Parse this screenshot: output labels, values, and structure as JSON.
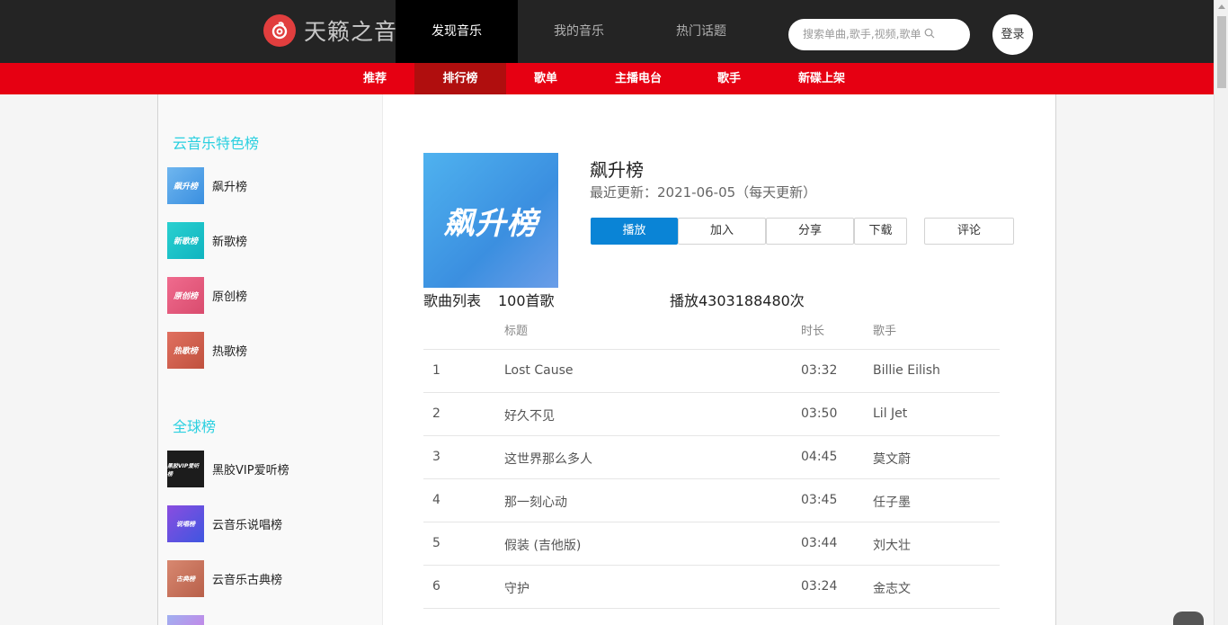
{
  "header": {
    "logo_text": "天籁之音",
    "nav": [
      "发现音乐",
      "我的音乐",
      "热门话题"
    ],
    "search_placeholder": "搜索单曲,歌手,视频,歌单",
    "login_label": "登录"
  },
  "subnav": [
    "推荐",
    "排行榜",
    "歌单",
    "主播电台",
    "歌手",
    "新碟上架"
  ],
  "sidebar": {
    "featured_title": "云音乐特色榜",
    "featured": [
      {
        "label": "飙升榜",
        "thumb": "飙升榜"
      },
      {
        "label": "新歌榜",
        "thumb": "新歌榜"
      },
      {
        "label": "原创榜",
        "thumb": "原创榜"
      },
      {
        "label": "热歌榜",
        "thumb": "热歌榜"
      }
    ],
    "global_title": "全球榜",
    "global": [
      {
        "label": "黑胶VIP爱听榜",
        "thumb": "黑胶VIP爱听榜"
      },
      {
        "label": "云音乐说唱榜",
        "thumb": "说唱榜"
      },
      {
        "label": "云音乐古典榜",
        "thumb": "古典榜"
      }
    ]
  },
  "rank": {
    "cover_text": "飙升榜",
    "title": "飙升榜",
    "update": "最近更新：2021-06-05（每天更新）",
    "buttons": [
      "播放",
      "加入",
      "分享",
      "下载",
      "评论"
    ],
    "list_title": "歌曲列表",
    "song_count": "100首歌",
    "play_count": "播放4303188480次"
  },
  "table": {
    "headers": [
      "标题",
      "时长",
      "歌手"
    ],
    "rows": [
      {
        "no": "1",
        "title": "Lost Cause",
        "duration": "03:32",
        "artist": "Billie Eilish"
      },
      {
        "no": "2",
        "title": "好久不见",
        "duration": "03:50",
        "artist": "Lil Jet"
      },
      {
        "no": "3",
        "title": "这世界那么多人",
        "duration": "04:45",
        "artist": "莫文蔚"
      },
      {
        "no": "4",
        "title": "那一刻心动",
        "duration": "03:45",
        "artist": "任子墨"
      },
      {
        "no": "5",
        "title": "假装 (吉他版)",
        "duration": "03:44",
        "artist": "刘大壮"
      },
      {
        "no": "6",
        "title": "守护",
        "duration": "03:24",
        "artist": "金志文"
      }
    ]
  },
  "colors": {
    "topbar": "#242424",
    "subnav_red": "#e60012",
    "accent_cyan": "#2bd0e0",
    "play_blue": "#0a84d6"
  }
}
